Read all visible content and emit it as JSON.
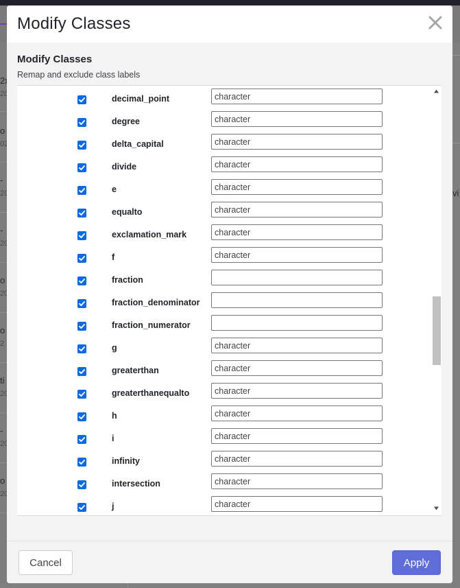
{
  "modal": {
    "title": "Modify Classes",
    "section_title": "Modify Classes",
    "section_subtitle": "Remap and exclude class labels",
    "cancel_label": "Cancel",
    "apply_label": "Apply"
  },
  "classes": [
    {
      "label": "decimal_point",
      "value": "character",
      "checked": true
    },
    {
      "label": "degree",
      "value": "character",
      "checked": true
    },
    {
      "label": "delta_capital",
      "value": "character",
      "checked": true
    },
    {
      "label": "divide",
      "value": "character",
      "checked": true
    },
    {
      "label": "e",
      "value": "character",
      "checked": true
    },
    {
      "label": "equalto",
      "value": "character",
      "checked": true
    },
    {
      "label": "exclamation_mark",
      "value": "character",
      "checked": true
    },
    {
      "label": "f",
      "value": "character",
      "checked": true
    },
    {
      "label": "fraction",
      "value": "",
      "checked": true
    },
    {
      "label": "fraction_denominator",
      "value": "",
      "checked": true
    },
    {
      "label": "fraction_numerator",
      "value": "",
      "checked": true
    },
    {
      "label": "g",
      "value": "character",
      "checked": true
    },
    {
      "label": "greaterthan",
      "value": "character",
      "checked": true
    },
    {
      "label": "greaterthanequalto",
      "value": "character",
      "checked": true
    },
    {
      "label": "h",
      "value": "character",
      "checked": true
    },
    {
      "label": "i",
      "value": "character",
      "checked": true
    },
    {
      "label": "infinity",
      "value": "character",
      "checked": true
    },
    {
      "label": "intersection",
      "value": "character",
      "checked": true
    },
    {
      "label": "j",
      "value": "character",
      "checked": true
    }
  ],
  "background": {
    "left_fragments": [
      "2x",
      "20",
      "o",
      "02",
      "-",
      "20",
      "-",
      "20",
      "o",
      "20",
      "o",
      "2",
      "ti",
      "20",
      "-",
      "20",
      "o",
      "20"
    ],
    "right_fragment": "vi"
  },
  "icons": {
    "close": "close-icon",
    "checkbox": "checkmark-icon",
    "scroll_up": "triangle-up-icon",
    "scroll_down": "triangle-down-icon"
  },
  "colors": {
    "checkbox": "#0b6ae0",
    "apply_button": "#5f6dd6",
    "modal_body": "#f3f3f3",
    "backdrop": "#7a7a7a"
  }
}
